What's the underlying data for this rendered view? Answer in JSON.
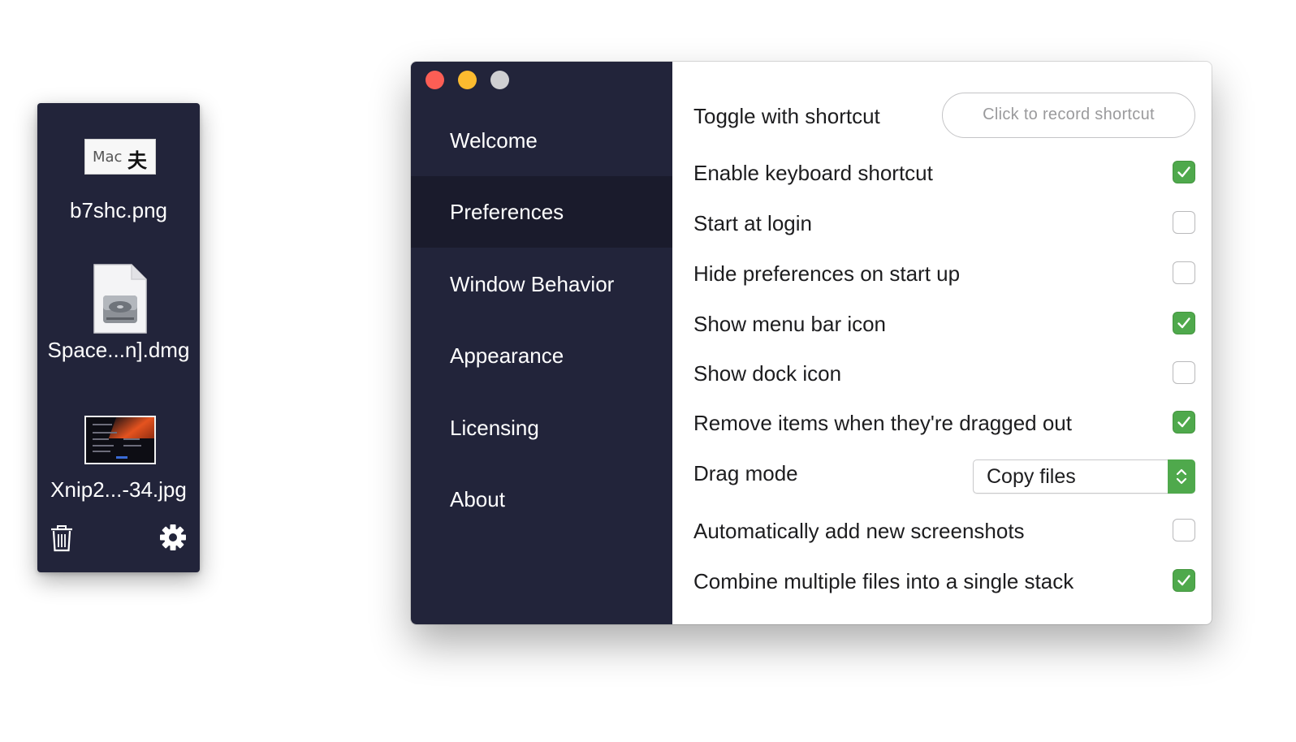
{
  "shelf": {
    "files": [
      {
        "name": "b7shc.png",
        "thumb_text": "Mac",
        "thumb_glyph": "夫"
      },
      {
        "name": "Space...n].dmg"
      },
      {
        "name": "Xnip2...-34.jpg"
      }
    ],
    "icons": {
      "trash": "trash-icon",
      "settings": "gear-icon"
    }
  },
  "window": {
    "sidebar": {
      "items": [
        {
          "label": "Welcome",
          "active": false
        },
        {
          "label": "Preferences",
          "active": true
        },
        {
          "label": "Window Behavior",
          "active": false
        },
        {
          "label": "Appearance",
          "active": false
        },
        {
          "label": "Licensing",
          "active": false
        },
        {
          "label": "About",
          "active": false
        }
      ]
    },
    "preferences": {
      "toggle_shortcut_label": "Toggle with shortcut",
      "record_shortcut_placeholder": "Click to record shortcut",
      "options": [
        {
          "label": "Enable keyboard shortcut",
          "checked": true
        },
        {
          "label": "Start at login",
          "checked": false
        },
        {
          "label": "Hide preferences on start up",
          "checked": false
        },
        {
          "label": "Show menu bar icon",
          "checked": true
        },
        {
          "label": "Show dock icon",
          "checked": false
        },
        {
          "label": "Remove items when they're dragged out",
          "checked": true
        }
      ],
      "drag_mode": {
        "label": "Drag mode",
        "value": "Copy files"
      },
      "options_after": [
        {
          "label": "Automatically add new screenshots",
          "checked": false
        },
        {
          "label": "Combine multiple files into a single stack",
          "checked": true
        }
      ]
    }
  },
  "colors": {
    "sidebar_bg": "#22243a",
    "sidebar_active_bg": "#1a1b2c",
    "accent_green": "#4fa94c",
    "traffic_close": "#fc5e55",
    "traffic_minimize": "#fcbb2f",
    "traffic_zoom": "#cfcfd1"
  }
}
